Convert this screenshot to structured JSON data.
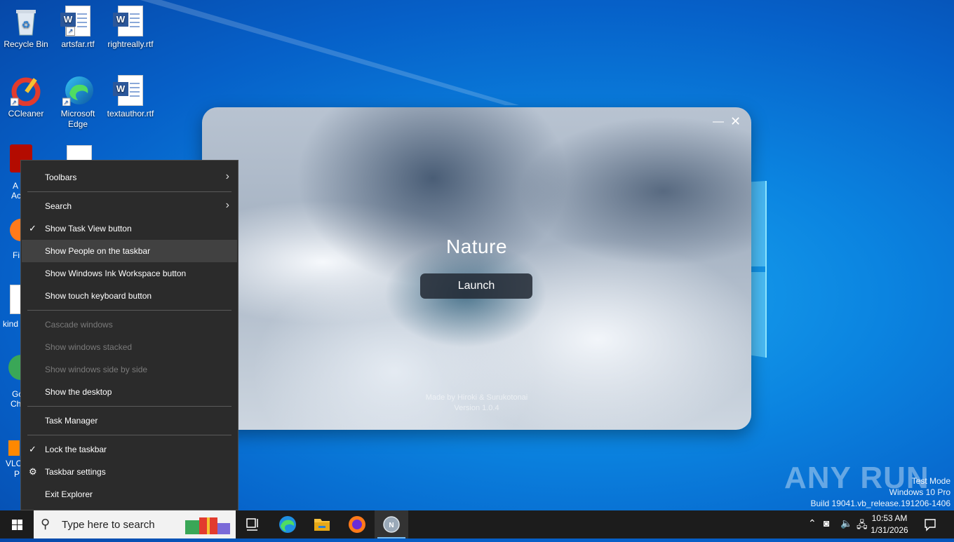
{
  "desktop": {
    "icons": [
      {
        "label": "Recycle Bin"
      },
      {
        "label": "artsfar.rtf"
      },
      {
        "label": "rightreally.rtf"
      },
      {
        "label": "CCleaner"
      },
      {
        "label": "Microsoft Edge"
      },
      {
        "label": "textauthor.rtf"
      }
    ],
    "partial_labels": [
      "A",
      "Ac",
      "Fi",
      "kind",
      "Go",
      "Ch",
      "VLC",
      "P"
    ]
  },
  "app_window": {
    "title": "Nature",
    "launch_label": "Launch",
    "credits_line1": "Made by Hiroki & Surukotonai",
    "credits_line2": "Version 1.0.4"
  },
  "context_menu": {
    "items": [
      {
        "label": "Toolbars",
        "submenu": true
      },
      {
        "label": "Search",
        "submenu": true
      },
      {
        "label": "Show Task View button",
        "checked": true
      },
      {
        "label": "Show People on the taskbar",
        "hovered": true
      },
      {
        "label": "Show Windows Ink Workspace button"
      },
      {
        "label": "Show touch keyboard button"
      },
      {
        "label": "Cascade windows",
        "disabled": true
      },
      {
        "label": "Show windows stacked",
        "disabled": true
      },
      {
        "label": "Show windows side by side",
        "disabled": true
      },
      {
        "label": "Show the desktop"
      },
      {
        "label": "Task Manager"
      },
      {
        "label": "Lock the taskbar",
        "checked": true
      },
      {
        "label": "Taskbar settings",
        "icon": "gear-icon"
      },
      {
        "label": "Exit Explorer"
      }
    ]
  },
  "watermark": {
    "brand": "ANY RUN",
    "line1": "Test Mode",
    "line2": "Windows 10 Pro",
    "line3": "Build 19041.vb_release.191206-1406"
  },
  "taskbar": {
    "search_placeholder": "Type here to search",
    "pinned": [
      "task-view-icon",
      "edge-icon",
      "file-explorer-icon",
      "firefox-icon",
      "nature-app-icon"
    ],
    "clock_time": "10:53 AM",
    "clock_date": "1/31/2026"
  },
  "colors": {
    "desktop_blue": "#0b84e0",
    "menu_bg": "#2b2b2b",
    "taskbar_bg": "#1c1c1c",
    "word_blue": "#2b579a"
  }
}
